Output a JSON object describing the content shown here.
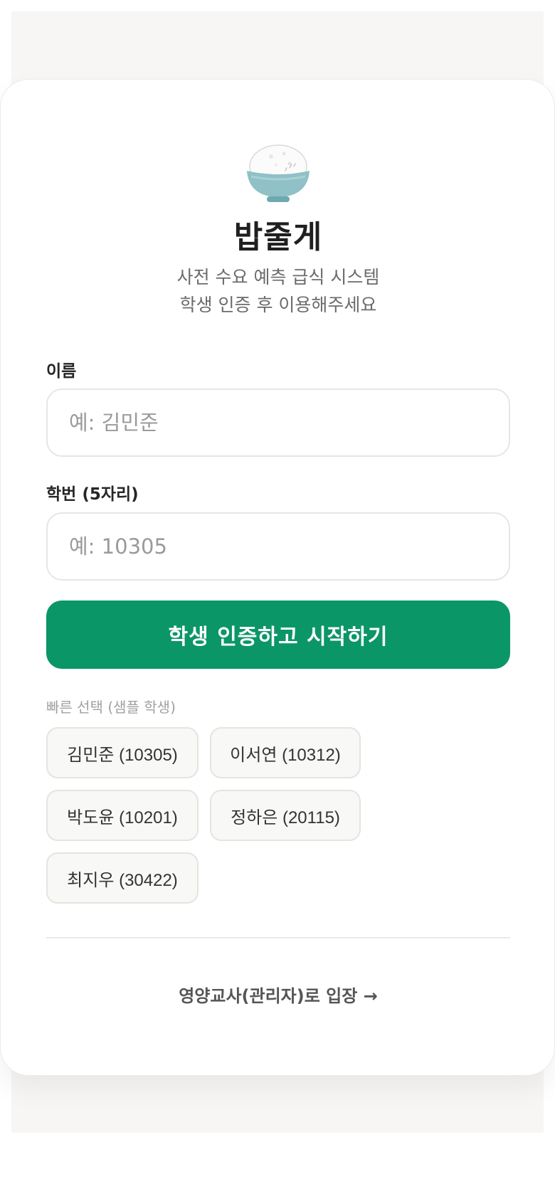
{
  "app": {
    "title": "밥줄게",
    "subtitle_line1": "사전 수요 예측 급식 시스템",
    "subtitle_line2": "학생 인증 후 이용해주세요",
    "logo_icon": "rice-bowl-icon"
  },
  "form": {
    "name_label": "이름",
    "name_value": "",
    "name_placeholder": "예: 김민준",
    "id_label": "학번 (5자리)",
    "id_value": "",
    "id_placeholder": "예: 10305",
    "submit_label": "학생 인증하고 시작하기"
  },
  "quick_select": {
    "label": "빠른 선택 (샘플 학생)",
    "students": [
      "김민준 (10305)",
      "이서연 (10312)",
      "박도윤 (10201)",
      "정하은 (20115)",
      "최지우 (30422)"
    ]
  },
  "footer": {
    "admin_link": "영양교사(관리자)로 입장 →"
  },
  "colors": {
    "primary": "#0b9668",
    "background": "#f7f6f4",
    "card": "#ffffff",
    "bowl": "#8fc1c6"
  }
}
